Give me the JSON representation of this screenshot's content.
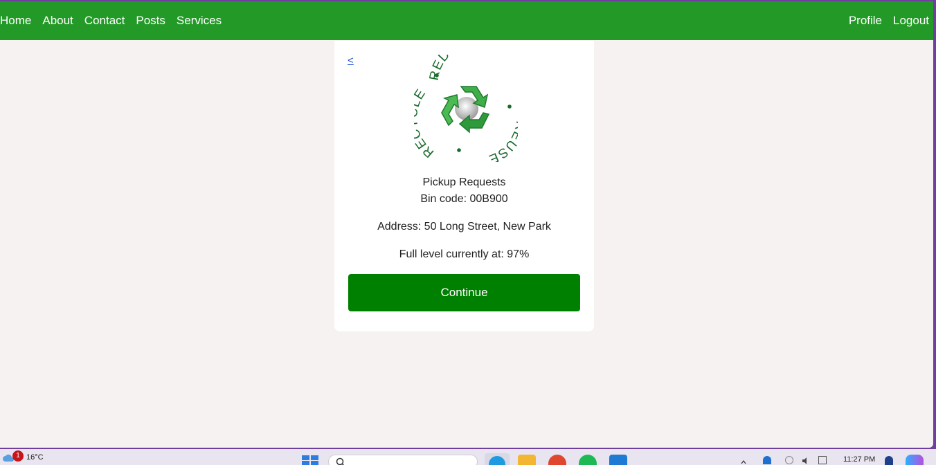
{
  "nav": {
    "left_links": [
      "Home",
      "About",
      "Contact",
      "Posts",
      "Services"
    ],
    "right_links": [
      "Profile",
      "Logout"
    ]
  },
  "card": {
    "back_label": "<",
    "logo_text": {
      "top": "REDUCE",
      "right": "REUSE",
      "left": "RECYCLE"
    },
    "title": "Pickup Requests",
    "bin_code": "Bin code: 00B900",
    "address": "Address: 50 Long Street, New Park",
    "full_level": "Full level currently at: 97%",
    "continue_label": "Continue"
  },
  "taskbar": {
    "weather_badge": "1",
    "weather_temp": "16°C",
    "clock_time": "11:27 PM"
  },
  "colors": {
    "navbar": "#239a27",
    "button": "#008000",
    "page_bg": "#f5f2f1",
    "link": "#1a4fd6",
    "logo_green": "#1a6b2e"
  }
}
